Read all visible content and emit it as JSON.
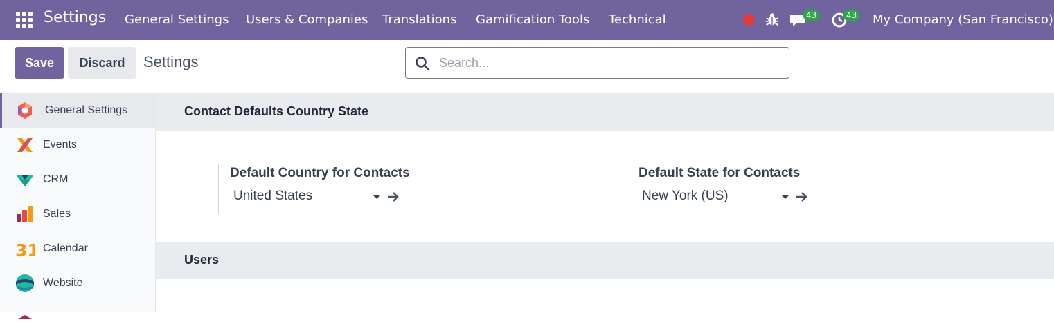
{
  "navbar": {
    "brand": "Settings",
    "menu": [
      {
        "label": "General Settings"
      },
      {
        "label": "Users & Companies"
      },
      {
        "label": "Translations"
      },
      {
        "label": "Gamification Tools"
      },
      {
        "label": "Technical"
      }
    ],
    "messages_count": "43",
    "activities_count": "43",
    "company": "My Company (San Francisco)"
  },
  "control_panel": {
    "save_label": "Save",
    "discard_label": "Discard",
    "title": "Settings",
    "search_placeholder": "Search..."
  },
  "sidebar": {
    "items": [
      {
        "label": "General Settings",
        "icon": "general-settings-icon"
      },
      {
        "label": "Events",
        "icon": "events-icon"
      },
      {
        "label": "CRM",
        "icon": "crm-icon"
      },
      {
        "label": "Sales",
        "icon": "sales-icon"
      },
      {
        "label": "Calendar",
        "icon": "calendar-icon"
      },
      {
        "label": "Website",
        "icon": "website-icon"
      }
    ],
    "calendar_icon_text": "31"
  },
  "sections": [
    {
      "title": "Contact Defaults Country State",
      "settings": [
        {
          "label": "Default Country for Contacts",
          "value": "United States"
        },
        {
          "label": "Default State for Contacts",
          "value": "New York (US)"
        }
      ]
    },
    {
      "title": "Users"
    }
  ],
  "colors": {
    "brand": "#71639e",
    "badge": "#28a745",
    "recording_dot": "#e03b3b"
  }
}
